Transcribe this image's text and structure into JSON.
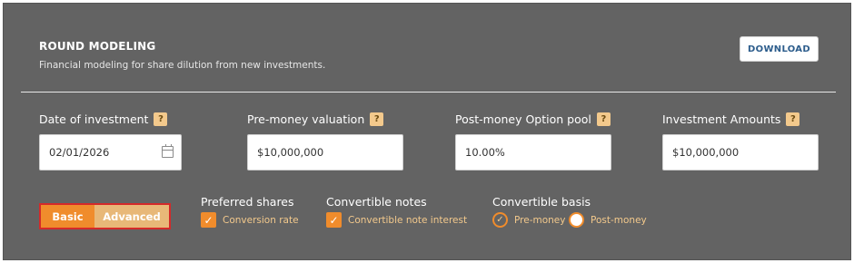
{
  "header": {
    "title": "ROUND MODELING",
    "subtitle": "Financial modeling for share dilution from new investments.",
    "download_label": "DOWNLOAD"
  },
  "fields": [
    {
      "label": "Date of investment",
      "value": "02/01/2026",
      "help": "?"
    },
    {
      "label": "Pre-money valuation",
      "value": "$10,000,000",
      "help": "?"
    },
    {
      "label": "Post-money Option pool",
      "value": "10.00%",
      "help": "?"
    },
    {
      "label": "Investment Amounts",
      "value": "$10,000,000",
      "help": "?"
    }
  ],
  "mode": {
    "basic_label": "Basic",
    "advanced_label": "Advanced",
    "selected": "Basic"
  },
  "preferred_shares": {
    "title": "Preferred shares",
    "option_label": "Conversion rate",
    "checked": true
  },
  "convertible_notes": {
    "title": "Convertible notes",
    "option_label": "Convertible note interest",
    "checked": true
  },
  "convertible_basis": {
    "title": "Convertible basis",
    "options": [
      {
        "label": "Pre-money",
        "selected": true
      },
      {
        "label": "Post-money",
        "selected": false
      }
    ]
  },
  "colors": {
    "panel_bg": "#636363",
    "accent_orange": "#f08c2c",
    "accent_light": "#f3c98c",
    "highlight_border": "#d42a2a"
  },
  "icons": {
    "calendar": "calendar-icon",
    "help": "help-icon",
    "check": "check-icon"
  }
}
